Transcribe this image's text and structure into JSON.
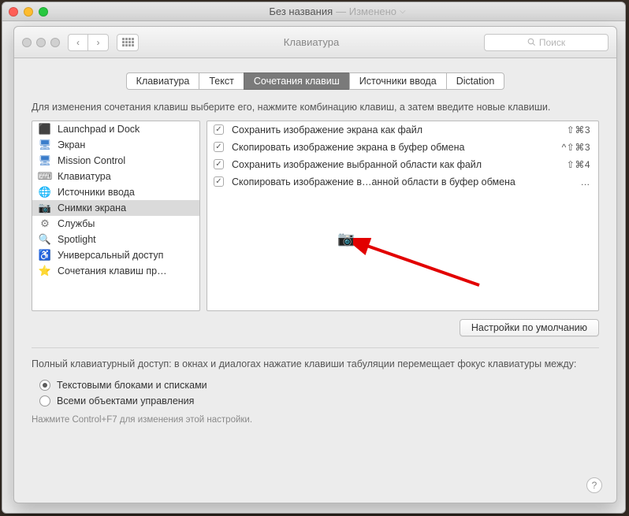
{
  "parent_window": {
    "title": "Без названия",
    "subtitle": "— Изменено"
  },
  "prefs": {
    "title": "Клавиатура",
    "search_placeholder": "Поиск",
    "tabs": [
      {
        "label": "Клавиатура"
      },
      {
        "label": "Текст"
      },
      {
        "label": "Сочетания клавиш"
      },
      {
        "label": "Источники ввода"
      },
      {
        "label": "Dictation"
      }
    ],
    "instruction": "Для изменения сочетания клавиш выберите его, нажмите комбинацию клавиш, а затем введите новые клавиши.",
    "categories": [
      {
        "icon": "launchpad",
        "label": "Launchpad и Dock"
      },
      {
        "icon": "display",
        "label": "Экран"
      },
      {
        "icon": "mission",
        "label": "Mission Control"
      },
      {
        "icon": "keyboard",
        "label": "Клавиатура"
      },
      {
        "icon": "input",
        "label": "Источники ввода"
      },
      {
        "icon": "camera",
        "label": "Снимки экрана"
      },
      {
        "icon": "services",
        "label": "Службы"
      },
      {
        "icon": "spotlight",
        "label": "Spotlight"
      },
      {
        "icon": "accessibility",
        "label": "Универсальный доступ"
      },
      {
        "icon": "appshortcuts",
        "label": "Сочетания клавиш пр…"
      }
    ],
    "selected_category_index": 5,
    "shortcuts": [
      {
        "checked": true,
        "label": "Сохранить изображение экрана как файл",
        "keys": "⇧⌘3"
      },
      {
        "checked": true,
        "label": "Скопировать изображение экрана в буфер обмена",
        "keys": "^⇧⌘3"
      },
      {
        "checked": true,
        "label": "Сохранить изображение выбранной области как файл",
        "keys": "⇧⌘4"
      },
      {
        "checked": true,
        "label": "Скопировать изображение в…анной области в буфер обмена",
        "keys": "…"
      }
    ],
    "defaults_button": "Настройки по умолчанию",
    "full_access_text": "Полный клавиатурный доступ: в окнах и диалогах нажатие клавиши табуляции перемещает фокус клавиатуры между:",
    "radios": [
      {
        "label": "Текстовыми блоками и списками"
      },
      {
        "label": "Всеми объектами управления"
      }
    ],
    "selected_radio_index": 0,
    "hint": "Нажмите Control+F7 для изменения этой настройки.",
    "help": "?"
  }
}
